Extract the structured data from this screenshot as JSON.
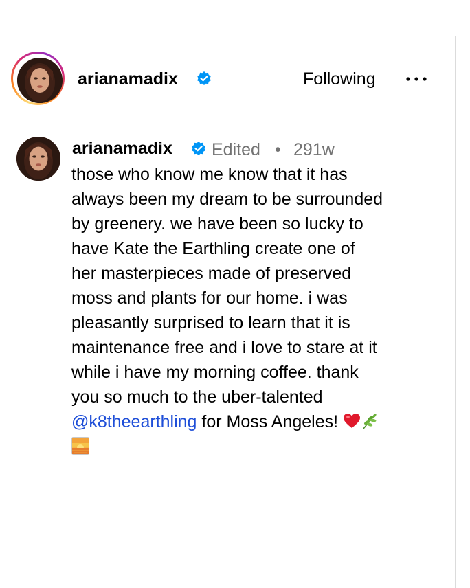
{
  "header": {
    "username": "arianamadix",
    "following_label": "Following",
    "more_label": "•••"
  },
  "caption": {
    "username": "arianamadix",
    "edited_label": "Edited",
    "separator": "•",
    "age": "291w",
    "lines": [
      "those who know me know that it has",
      "always been my dream to be surrounded",
      "by greenery. we have been so lucky to",
      "have Kate the Earthling create one of",
      "her masterpieces made of preserved",
      "moss and plants for our home. i was",
      "pleasantly surprised to learn that it is",
      "maintenance free and i love to stare at it",
      "while i have my morning coffee. thank",
      "you so much to the uber-talented"
    ],
    "mention": "@k8theearthling",
    "after_mention": " for Moss Angeles! ",
    "emojis": [
      "red-heart",
      "herb",
      "sunrise"
    ]
  },
  "colors": {
    "mention": "#1f4fd8",
    "verified": "#0095f6",
    "muted": "#737373",
    "divider": "#dbdbdb"
  }
}
